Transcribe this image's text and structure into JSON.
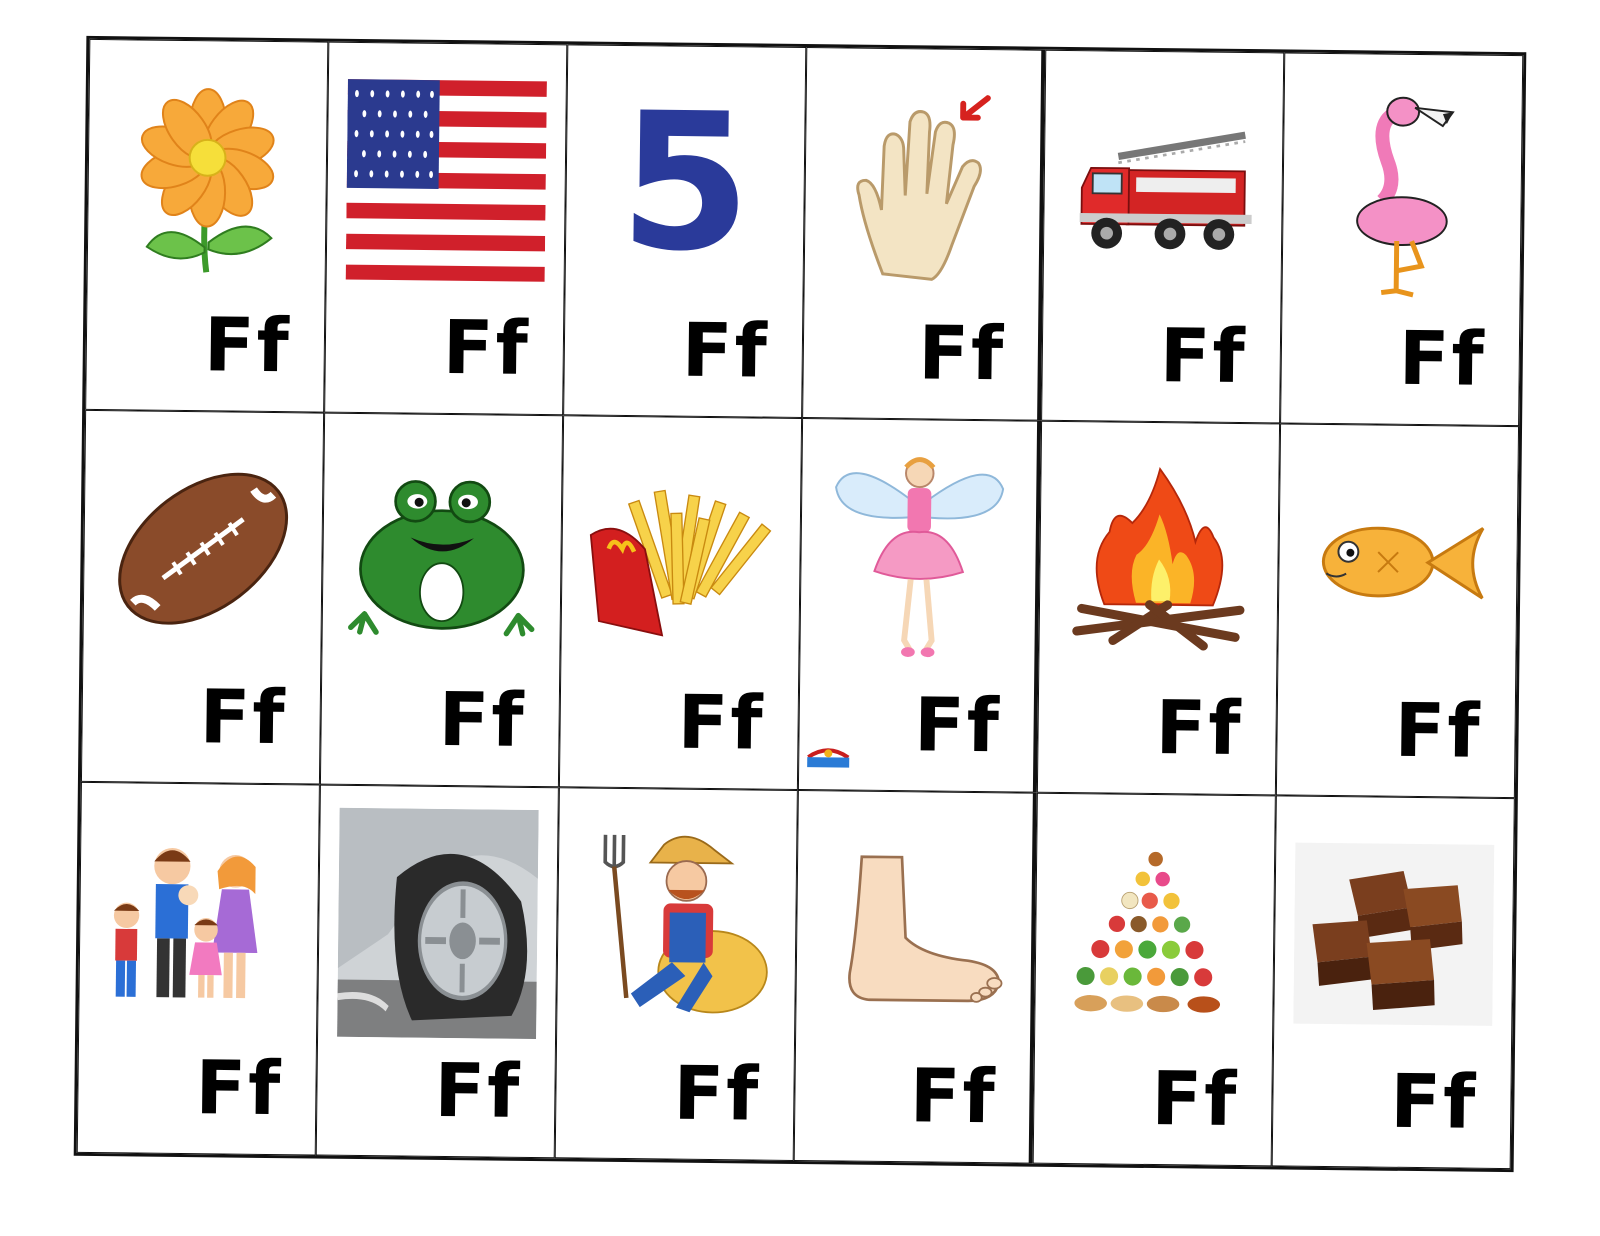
{
  "cards": [
    {
      "letter": "Ff",
      "icon": "flower-icon"
    },
    {
      "letter": "Ff",
      "icon": "flag-icon"
    },
    {
      "letter": "Ff",
      "icon": "five-icon",
      "text": "5"
    },
    {
      "letter": "Ff",
      "icon": "finger-icon"
    },
    {
      "letter": "Ff",
      "icon": "fire-truck-icon"
    },
    {
      "letter": "Ff",
      "icon": "flamingo-icon"
    },
    {
      "letter": "Ff",
      "icon": "football-icon"
    },
    {
      "letter": "Ff",
      "icon": "frog-icon"
    },
    {
      "letter": "Ff",
      "icon": "fries-icon"
    },
    {
      "letter": "Ff",
      "icon": "fairy-icon"
    },
    {
      "letter": "Ff",
      "icon": "fire-icon"
    },
    {
      "letter": "Ff",
      "icon": "fish-icon"
    },
    {
      "letter": "Ff",
      "icon": "family-icon"
    },
    {
      "letter": "Ff",
      "icon": "flat-tire-icon"
    },
    {
      "letter": "Ff",
      "icon": "farmer-icon"
    },
    {
      "letter": "Ff",
      "icon": "foot-icon"
    },
    {
      "letter": "Ff",
      "icon": "food-pyramid-icon"
    },
    {
      "letter": "Ff",
      "icon": "fudge-icon"
    }
  ],
  "colors": {
    "border": "#111111",
    "text": "#000000",
    "five": "#2a3a9a"
  }
}
